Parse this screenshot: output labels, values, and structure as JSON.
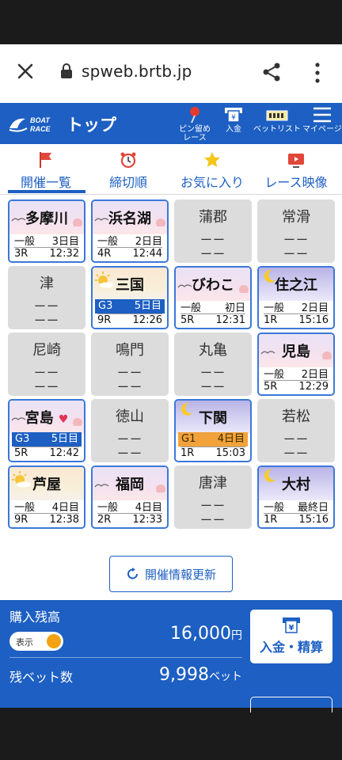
{
  "browser": {
    "url": "spweb.brtb.jp"
  },
  "header": {
    "logo_text": "BOAT RACE",
    "title": "トップ",
    "buttons": [
      {
        "label1": "ピン留め",
        "label2": "レース",
        "icon": "pin-icon"
      },
      {
        "label1": "入金",
        "label2": "",
        "icon": "deposit-icon"
      },
      {
        "label1": "ベットリスト",
        "label2": "",
        "icon": "betlist-icon"
      },
      {
        "label1": "マイページ",
        "label2": "",
        "icon": "menu-icon"
      }
    ]
  },
  "tabs": [
    {
      "label": "開催一覧",
      "icon": "flag-icon",
      "active": true
    },
    {
      "label": "締切順",
      "icon": "alarm-clock-icon"
    },
    {
      "label": "お気に入り",
      "icon": "star-icon"
    },
    {
      "label": "レース映像",
      "icon": "video-icon"
    }
  ],
  "venues": [
    {
      "name": "多摩川",
      "active": true,
      "theme": "day",
      "grade": "一般",
      "day": "3日目",
      "race": "3R",
      "time": "12:32"
    },
    {
      "name": "浜名湖",
      "active": true,
      "theme": "day",
      "grade": "一般",
      "day": "2日目",
      "race": "4R",
      "time": "12:44"
    },
    {
      "name": "蒲郡",
      "active": false,
      "dash1": "ーー",
      "dash2": "ーー"
    },
    {
      "name": "常滑",
      "active": false,
      "dash1": "ーー",
      "dash2": "ーー"
    },
    {
      "name": "津",
      "active": false,
      "dash1": "ーー",
      "dash2": "ーー"
    },
    {
      "name": "三国",
      "active": true,
      "theme": "morning",
      "grade": "G3",
      "day": "5日目",
      "race": "9R",
      "time": "12:26",
      "badge": "blue"
    },
    {
      "name": "びわこ",
      "active": true,
      "theme": "day",
      "grade": "一般",
      "day": "初日",
      "race": "5R",
      "time": "12:31"
    },
    {
      "name": "住之江",
      "active": true,
      "theme": "night",
      "grade": "一般",
      "day": "2日目",
      "race": "1R",
      "time": "15:16"
    },
    {
      "name": "尼崎",
      "active": false,
      "dash1": "ーー",
      "dash2": "ーー"
    },
    {
      "name": "鳴門",
      "active": false,
      "dash1": "ーー",
      "dash2": "ーー"
    },
    {
      "name": "丸亀",
      "active": false,
      "dash1": "ーー",
      "dash2": "ーー"
    },
    {
      "name": "児島",
      "active": true,
      "theme": "day",
      "grade": "一般",
      "day": "2日目",
      "race": "5R",
      "time": "12:29"
    },
    {
      "name": "宮島",
      "active": true,
      "theme": "day",
      "grade": "G3",
      "day": "5日目",
      "race": "5R",
      "time": "12:42",
      "badge": "blue",
      "favorite": true
    },
    {
      "name": "徳山",
      "active": false,
      "dash1": "ーー",
      "dash2": "ーー"
    },
    {
      "name": "下関",
      "active": true,
      "theme": "night",
      "grade": "G1",
      "day": "4日目",
      "race": "1R",
      "time": "15:03",
      "badge": "orange"
    },
    {
      "name": "若松",
      "active": false,
      "dash1": "ーー",
      "dash2": "ーー"
    },
    {
      "name": "芦屋",
      "active": true,
      "theme": "morning",
      "grade": "一般",
      "day": "4日目",
      "race": "9R",
      "time": "12:38"
    },
    {
      "name": "福岡",
      "active": true,
      "theme": "day",
      "grade": "一般",
      "day": "4日目",
      "race": "2R",
      "time": "12:33"
    },
    {
      "name": "唐津",
      "active": false,
      "dash1": "ーー",
      "dash2": "ーー"
    },
    {
      "name": "大村",
      "active": true,
      "theme": "night",
      "grade": "一般",
      "day": "最終日",
      "race": "1R",
      "time": "15:16"
    }
  ],
  "refresh_label": "開催情報更新",
  "wallet": {
    "balance_label": "購入残高",
    "toggle_label": "表示",
    "balance_value": "16,000",
    "balance_unit": "円",
    "bets_label": "残ベット数",
    "bets_value": "9,998",
    "bets_unit": "ベット",
    "deposit_label": "入金・精算"
  },
  "colors": {
    "brand": "#1d5fc2",
    "g1": "#f2a23a",
    "g3": "#1d5fc2",
    "inactive": "#dcdcdc"
  }
}
